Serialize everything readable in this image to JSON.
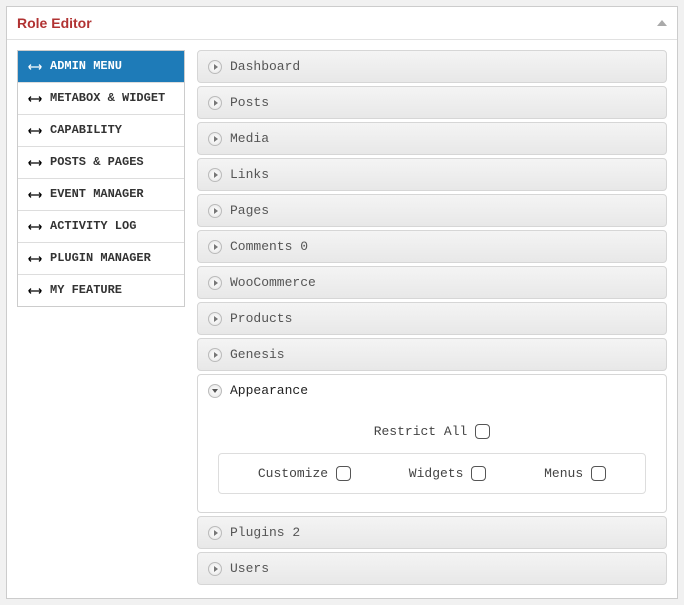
{
  "header": {
    "title": "Role Editor"
  },
  "sidebar": {
    "items": [
      {
        "label": "ADMIN MENU"
      },
      {
        "label": "METABOX & WIDGET"
      },
      {
        "label": "CAPABILITY"
      },
      {
        "label": "POSTS & PAGES"
      },
      {
        "label": "EVENT MANAGER"
      },
      {
        "label": "ACTIVITY LOG"
      },
      {
        "label": "PLUGIN MANAGER"
      },
      {
        "label": "MY FEATURE"
      }
    ]
  },
  "accordion": {
    "items": [
      {
        "label": "Dashboard"
      },
      {
        "label": "Posts"
      },
      {
        "label": "Media"
      },
      {
        "label": "Links"
      },
      {
        "label": "Pages"
      },
      {
        "label": "Comments 0"
      },
      {
        "label": "WooCommerce"
      },
      {
        "label": "Products"
      },
      {
        "label": "Genesis"
      },
      {
        "label": "Appearance"
      },
      {
        "label": "Plugins 2"
      },
      {
        "label": "Users"
      }
    ]
  },
  "appearance": {
    "restrict_all": "Restrict All",
    "options": [
      {
        "label": "Customize"
      },
      {
        "label": "Widgets"
      },
      {
        "label": "Menus"
      }
    ]
  }
}
